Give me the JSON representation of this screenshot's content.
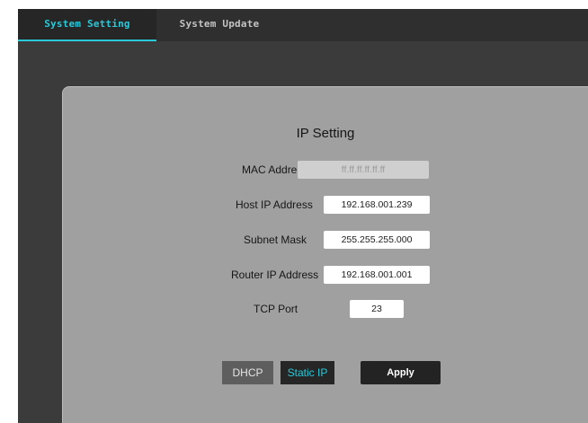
{
  "tabs": [
    {
      "label": "System Setting",
      "active": true
    },
    {
      "label": "System Update",
      "active": false
    }
  ],
  "panel": {
    "title": "IP Setting",
    "fields": {
      "mac": {
        "label": "MAC Address",
        "value": "ff.ff.ff.ff.ff.ff",
        "readonly": true
      },
      "host_ip": {
        "label": "Host IP Address",
        "value": "192.168.001.239"
      },
      "subnet": {
        "label": "Subnet Mask",
        "value": "255.255.255.000"
      },
      "router_ip": {
        "label": "Router IP Address",
        "value": "192.168.001.001"
      },
      "tcp_port": {
        "label": "TCP Port",
        "value": "23"
      }
    },
    "buttons": {
      "dhcp": "DHCP",
      "static_ip": "Static IP",
      "apply": "Apply"
    },
    "mode_selected": "Static IP"
  },
  "colors": {
    "accent": "#29c9d9",
    "tabbar_bg": "#2f2f2f",
    "app_bg": "#3b3b3b",
    "panel_bg": "#a0a0a0"
  }
}
